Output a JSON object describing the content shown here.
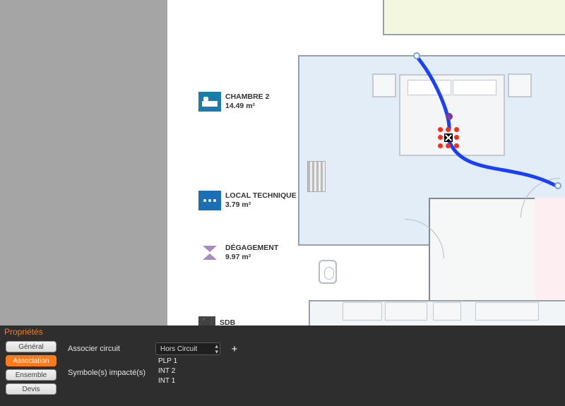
{
  "rooms": [
    {
      "name": "CHAMBRE 2",
      "area": "14.49 m²",
      "icon": "bed-icon",
      "color": "#1b7caa"
    },
    {
      "name": "LOCAL TECHNIQUE",
      "area": "3.79 m²",
      "icon": "dots-icon",
      "color": "#1a6fb5"
    },
    {
      "name": "DÉGAGEMENT",
      "area": "9.97 m²",
      "icon": "hourglass-icon",
      "color": "#7a5b8e"
    },
    {
      "name": "SDB",
      "area": "",
      "icon": "bath-icon",
      "color": "#444"
    }
  ],
  "panel": {
    "title": "Propriétés",
    "tabs": [
      "Général",
      "Association",
      "Ensemble",
      "Devis"
    ],
    "active_tab": 1,
    "associate_label": "Associer circuit",
    "circuit_selected": "Hors Circuit",
    "impacted_label": "Symbole(s) impacté(s)",
    "impacted": [
      "PLP 1",
      "INT 2",
      "INT 1"
    ]
  },
  "selection": {
    "type": "electrical-node",
    "wire_color": "#1a3fff",
    "endpoints": 2
  }
}
